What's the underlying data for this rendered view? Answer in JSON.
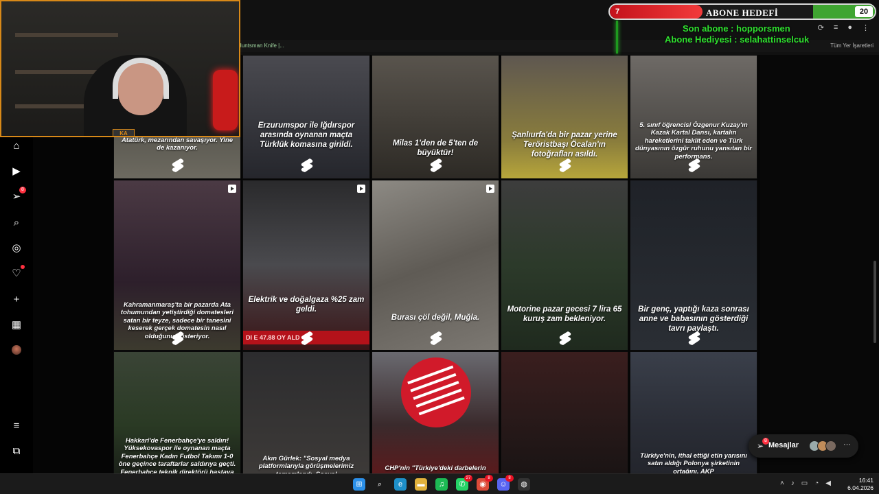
{
  "overlay": {
    "goal_current": "7",
    "goal_title": "ABONE HEDEFİ",
    "goal_target": "20",
    "goal_progress": 0.35,
    "last_sub": "Son abone : hopporsmen",
    "sub_gift": "Abone Hediyesi : selahattinselcuk",
    "cam_logo": "KA"
  },
  "browser": {
    "bookmark_left": "Huntsman Knife |...",
    "bookmark_right": "Tüm Yer İşaretleri"
  },
  "sidebar": {
    "items": [
      {
        "name": "home",
        "icon": "⌂"
      },
      {
        "name": "reels",
        "icon": "▶"
      },
      {
        "name": "messages",
        "icon": "➢",
        "badge": "8"
      },
      {
        "name": "search",
        "icon": "⌕"
      },
      {
        "name": "explore",
        "icon": "◎"
      },
      {
        "name": "notifications",
        "icon": "♡"
      },
      {
        "name": "create",
        "icon": "+"
      },
      {
        "name": "dashboard",
        "icon": "▦"
      },
      {
        "name": "profile",
        "icon": ""
      }
    ],
    "more_icon": "≡",
    "meta_icon": "⧉"
  },
  "grid": {
    "tiles": [
      {
        "caption": "Atatürk, mezarından savaşıyor. Yine de kazanıyor.",
        "bg": "linear-gradient(180deg,#3a3a36,#6d6a60)"
      },
      {
        "caption": "Erzurumspor ile Iğdırspor arasında oynanan maçta Türklük komasına girildi.",
        "bg": "linear-gradient(180deg,#4a4a50,#25262c)"
      },
      {
        "caption": "Milas 1'den de 5'ten de büyüktür!",
        "bg": "linear-gradient(180deg,#59544d,#2d2a25)"
      },
      {
        "caption": "Şanlıurfa'da bir pazar yerine Teröristbaşı Öcalan'ın fotoğrafları asıldı.",
        "bg": "linear-gradient(180deg,#5e5750,#8a7d3c 70%,#b7a63b)"
      },
      {
        "caption": "5. sınıf öğrencisi Özgenur Kuzay'ın Kazak Kartal Dansı, kartalın hareketlerini taklit eden ve Türk dünyasının özgür ruhunu yansıtan bir performans.",
        "bg": "linear-gradient(180deg,#6e6a66,#3b3936)"
      },
      {
        "caption": "Kahramanmaraş'ta bir pazarda Ata tohumundan yetiştirdiği domatesleri satan bir teyze, sadece bir tanesini keserek gerçek domatesin nasıl olduğunu gösteriyor.",
        "bg": "linear-gradient(180deg,#4b3a44,#2d1f2b 60%,#3c3a2e)",
        "play": true
      },
      {
        "caption": "Elektrik ve doğalgaza %25 zam geldi.",
        "bg": "linear-gradient(180deg,#2a2a2c,#4a4a4e 50%,#3a1416)",
        "play": true,
        "ticker": "DI  E 47.88 OY ALD"
      },
      {
        "caption": "Burası çöl değil, Muğla.",
        "bg": "linear-gradient(160deg,#8d8a84,#5f5b55 50%,#7c7872)",
        "play": true
      },
      {
        "caption": "Motorine pazar gecesi 7 lira 65 kuruş zam bekleniyor.",
        "bg": "linear-gradient(180deg,#3d3d3d,#2c3a2a 50%,#1f2a1e)"
      },
      {
        "caption": "Bir genç, yaptığı kaza sonrası anne ve babasının gösterdiği tavrı paylaştı.",
        "bg": "linear-gradient(180deg,#1f2228,#2a2e34)"
      },
      {
        "caption": "Hakkari'de Fenerbahçe'ye saldırı! Yüksekovaspor ile oynanan maçta Fenerbahçe Kadın Futbol Takımı 1-0 öne geçince taraftarlar saldırıya geçti. Fenerbahçe teknik direktörü hastaya kaldı.",
        "bg": "linear-gradient(180deg,#3a4436,#2a3a24 60%,#1a1f18)"
      },
      {
        "caption": "Akın Gürlek: \"Sosyal medya platformlarıyla görüşmelerimiz tamamlandı. Sosyal",
        "bg": "linear-gradient(180deg,#2c2c2e,#3d3a38)"
      },
      {
        "caption": "CHP'nin \"Türkiye'deki darbelerin",
        "bg": "linear-gradient(180deg,#6a6a70,#3a2a2c 60%,#5a1a1c)"
      },
      {
        "caption": "",
        "bg": "linear-gradient(180deg,#3a1e1e,#2a1a1a 50%,#1a1414)"
      },
      {
        "caption": "Türkiye'nin, ithal ettiği etin yarısını satın aldığı Polonya şirketinin ortağını, AKP",
        "bg": "linear-gradient(180deg,#3a3f4a,#2a2d36 60%,#23252c)"
      }
    ]
  },
  "messages": {
    "label": "Mesajlar",
    "badge": "8"
  },
  "taskbar": {
    "apps": [
      {
        "name": "start",
        "glyph": "⊞",
        "color": "#2b8fe8"
      },
      {
        "name": "search",
        "glyph": "⌕",
        "color": "#1b1b1b"
      },
      {
        "name": "edge",
        "glyph": "e",
        "color": "#1e8fc8"
      },
      {
        "name": "files",
        "glyph": "▬",
        "color": "#e2b23c"
      },
      {
        "name": "spotify",
        "glyph": "♫",
        "color": "#1db954"
      },
      {
        "name": "whatsapp",
        "glyph": "✆",
        "color": "#25d366",
        "badge": "27"
      },
      {
        "name": "chrome",
        "glyph": "◉",
        "color": "#dd4b39",
        "badge": "8"
      },
      {
        "name": "discord",
        "glyph": "☺",
        "color": "#5865f2",
        "badge": "8"
      },
      {
        "name": "obs",
        "glyph": "◍",
        "color": "#333333"
      }
    ],
    "time": "16:41",
    "date": "6.04.2026"
  }
}
